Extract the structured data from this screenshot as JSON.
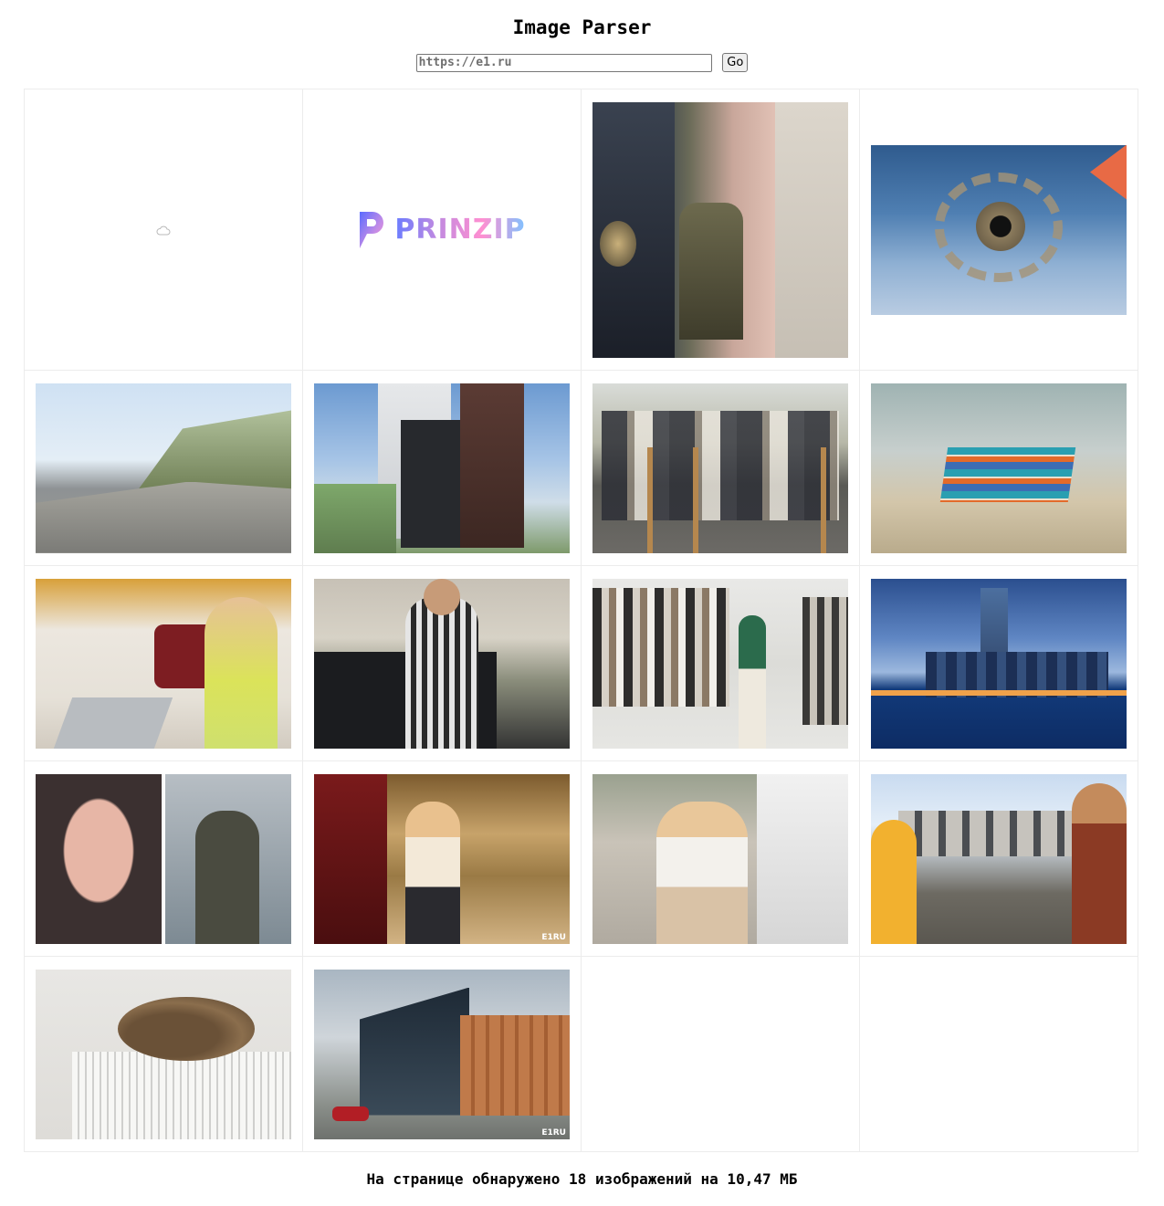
{
  "app": {
    "title": "Image Parser"
  },
  "form": {
    "url_placeholder": "https://e1.ru",
    "go_label": "Go"
  },
  "gallery": {
    "images": [
      {
        "icon": "cloud-icon",
        "subject": "placeholder"
      },
      {
        "logo_text": "PRINZIP"
      },
      {
        "subject": "police-stairwell"
      },
      {
        "subject": "camera-drone"
      },
      {
        "subject": "highway"
      },
      {
        "subject": "tower-building"
      },
      {
        "subject": "protest-crosses"
      },
      {
        "subject": "textbooks"
      },
      {
        "subject": "girl-laptop"
      },
      {
        "subject": "boy-car"
      },
      {
        "subject": "clothing-store"
      },
      {
        "subject": "city-skyline"
      },
      {
        "subject": "two-portraits"
      },
      {
        "subject": "theater-woman"
      },
      {
        "subject": "hugging-couple"
      },
      {
        "subject": "train-soldiers"
      },
      {
        "subject": "cat-radiator"
      },
      {
        "subject": "office-building"
      }
    ],
    "watermark_text": "E1RU"
  },
  "summary": "На странице обнаружено 18 изображений на 10,47 МБ"
}
